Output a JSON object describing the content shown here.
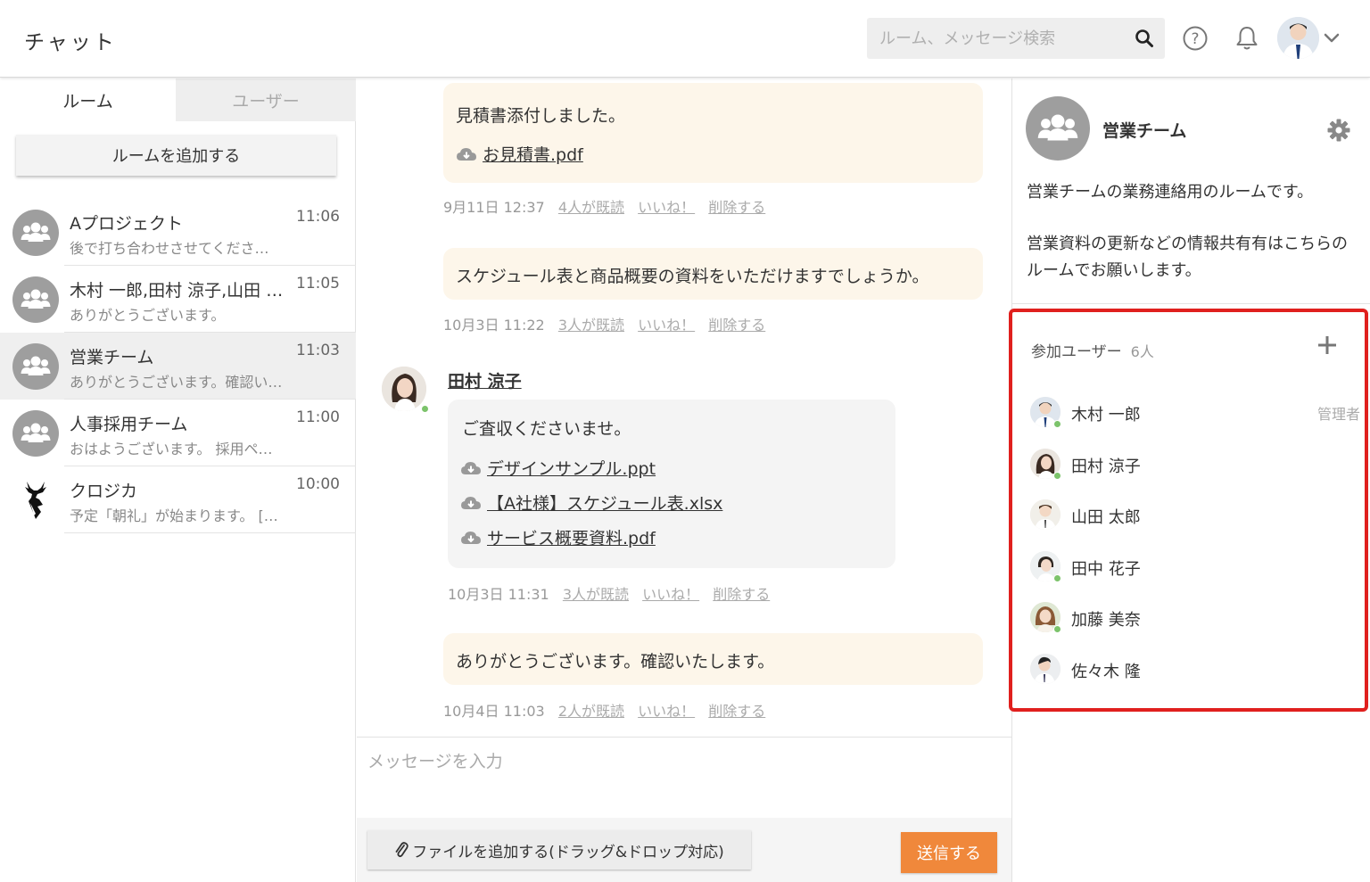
{
  "header": {
    "app_title": "チャット",
    "search_placeholder": "ルーム、メッセージ検索",
    "icons": [
      "search-icon",
      "help-icon",
      "bell-icon",
      "user-avatar",
      "chevron-down-icon"
    ]
  },
  "sidebar": {
    "tabs": [
      {
        "label": "ルーム",
        "active": true
      },
      {
        "label": "ユーザー",
        "active": false
      }
    ],
    "add_room_label": "ルームを追加する",
    "rooms": [
      {
        "name": "Aプロジェクト",
        "time": "11:06",
        "preview": "後で打ち合わせさせてくださ…",
        "active": false,
        "icon": "group-icon"
      },
      {
        "name": "木村 一郎,田村 涼子,山田 …",
        "time": "11:05",
        "preview": "ありがとうございます。",
        "active": false,
        "icon": "group-icon"
      },
      {
        "name": "営業チーム",
        "time": "11:03",
        "preview": "ありがとうございます。確認い…",
        "active": true,
        "icon": "group-icon"
      },
      {
        "name": "人事採用チーム",
        "time": "11:00",
        "preview": "おはようございます。 採用ペ…",
        "active": false,
        "icon": "group-icon"
      },
      {
        "name": "クロジカ",
        "time": "10:00",
        "preview": "予定「朝礼」が始まります。 […",
        "active": false,
        "icon": "deer-logo-icon"
      }
    ]
  },
  "chat": {
    "messages": [
      {
        "text": "見積書添付しました。",
        "files": [
          "お見積書.pdf"
        ],
        "meta": {
          "date": "9月11日 12:37",
          "read": "4人が既読",
          "like": "いいね！",
          "delete": "削除する"
        }
      },
      {
        "text": "スケジュール表と商品概要の資料をいただけますでしょうか。",
        "files": [],
        "meta": {
          "date": "10月3日 11:22",
          "read": "3人が既読",
          "like": "いいね！",
          "delete": "削除する"
        }
      },
      {
        "sender": "田村 涼子",
        "text": "ご査収くださいませ。",
        "files": [
          "デザインサンプル.ppt",
          "【A社様】スケジュール表.xlsx",
          "サービス概要資料.pdf"
        ],
        "meta": {
          "date": "10月3日 11:31",
          "read": "3人が既読",
          "like": "いいね！",
          "delete": "削除する"
        }
      },
      {
        "text": "ありがとうございます。確認いたします。",
        "files": [],
        "meta": {
          "date": "10月4日 11:03",
          "read": "2人が既読",
          "like": "いいね！",
          "delete": "削除する"
        }
      }
    ],
    "composer": {
      "placeholder": "メッセージを入力",
      "attach_label": "ファイルを追加する(ドラッグ&ドロップ対応)",
      "send_label": "送信する"
    }
  },
  "room_info": {
    "title": "営業チーム",
    "description": [
      "営業チームの業務連絡用のルームです。",
      "営業資料の更新などの情報共有有はこちらのルームでお願いします。"
    ],
    "members_label": "参加ユーザー",
    "members_count": "6人",
    "members": [
      {
        "name": "木村 一郎",
        "role": "管理者"
      },
      {
        "name": "田村 涼子",
        "role": ""
      },
      {
        "name": "山田 太郎",
        "role": ""
      },
      {
        "name": "田中 花子",
        "role": ""
      },
      {
        "name": "加藤 美奈",
        "role": ""
      },
      {
        "name": "佐々木 隆",
        "role": ""
      }
    ],
    "highlight_color": "#e0201e"
  },
  "colors": {
    "accent": "#f0883b",
    "bubble_own": "#fdf6ea",
    "bubble_other": "#f4f4f4",
    "online": "#7cc36b"
  }
}
